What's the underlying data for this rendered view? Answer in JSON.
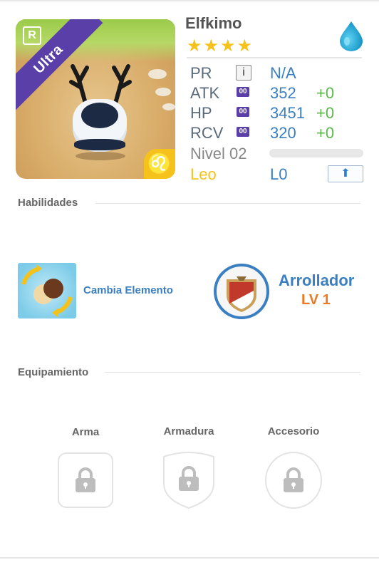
{
  "monster": {
    "name": "Elfkimo",
    "rarity": "Ultra",
    "rarity_badge": "R",
    "stars": "★★★★",
    "element_icon": "water-drop-icon",
    "zodiac_glyph": "♌"
  },
  "stats": {
    "pr": {
      "label": "PR",
      "icon": "i",
      "value": "N/A"
    },
    "atk": {
      "label": "ATK",
      "icon": "00",
      "value": "352",
      "bonus": "+0"
    },
    "hp": {
      "label": "HP",
      "icon": "00",
      "value": "3451",
      "bonus": "+0"
    },
    "rcv": {
      "label": "RCV",
      "icon": "00",
      "value": "320",
      "bonus": "+0"
    },
    "level": {
      "label": "Nivel 02"
    },
    "sign": {
      "label": "Leo",
      "value": "L0",
      "upgrade_icon": "⬆"
    }
  },
  "sections": {
    "skills_title": "Habilidades",
    "equipment_title": "Equipamiento"
  },
  "skill": {
    "name": "Cambia Elemento"
  },
  "ability": {
    "name": "Arrollador",
    "level": "LV 1"
  },
  "equipment": {
    "weapon": "Arma",
    "armor": "Armadura",
    "accessory": "Accesorio"
  },
  "colors": {
    "accent_blue": "#3a7fc1",
    "ultra_purple": "#5b3fa8",
    "star_gold": "#f4c21a",
    "bonus_green": "#5ab84a",
    "level_orange": "#f07820"
  }
}
